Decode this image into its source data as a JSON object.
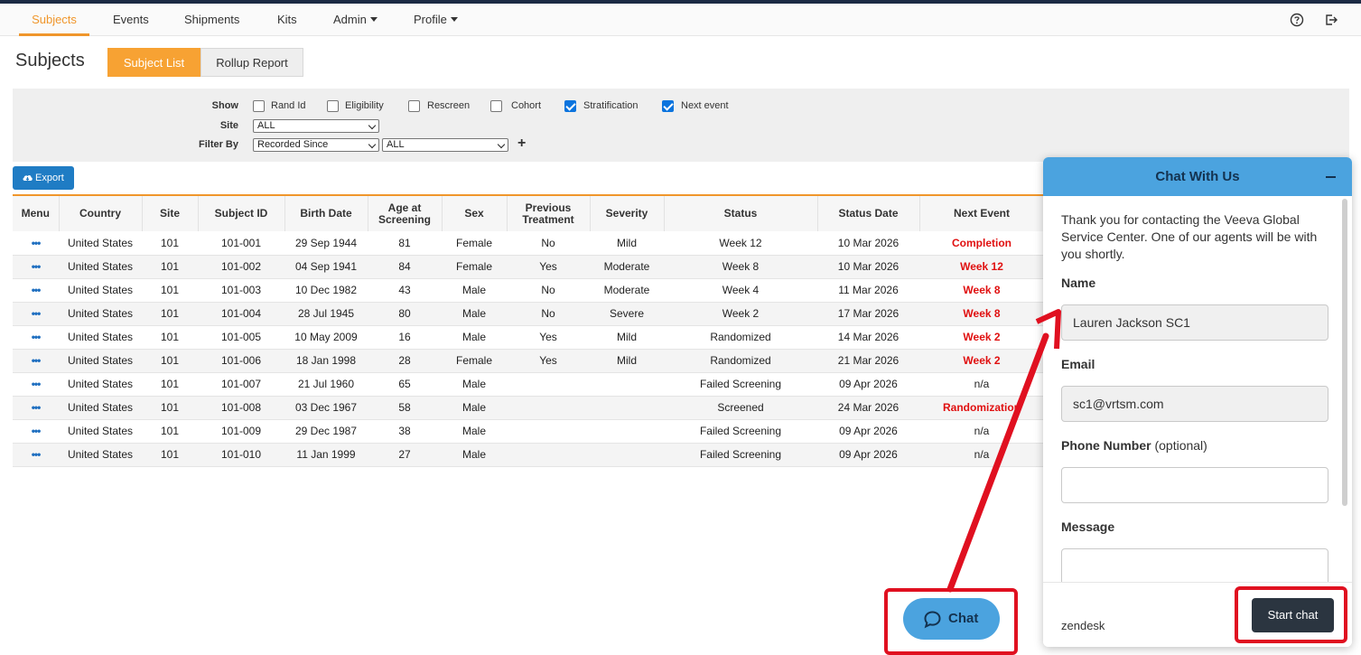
{
  "nav": {
    "items": [
      "Subjects",
      "Events",
      "Shipments",
      "Kits",
      "Admin",
      "Profile"
    ],
    "active": "Subjects",
    "help_icon": "help-circle-icon",
    "logout_icon": "logout-icon"
  },
  "page": {
    "title": "Subjects",
    "tabs": [
      "Subject List",
      "Rollup Report"
    ],
    "active_tab": "Subject List"
  },
  "filters": {
    "show_label": "Show",
    "show_options": [
      {
        "label": "Rand Id",
        "checked": false
      },
      {
        "label": "Eligibility",
        "checked": false
      },
      {
        "label": "Rescreen",
        "checked": false
      },
      {
        "label": "Cohort",
        "checked": false
      },
      {
        "label": "Stratification",
        "checked": true
      },
      {
        "label": "Next event",
        "checked": true
      }
    ],
    "site_label": "Site",
    "site_value": "ALL",
    "filter_by_label": "Filter By",
    "filter_by_value": "Recorded Since",
    "filter_value": "ALL",
    "add_symbol": "+"
  },
  "export": {
    "label": "Export",
    "icon": "cloud-download-icon"
  },
  "table": {
    "headers": [
      "Menu",
      "Country",
      "Site",
      "Subject ID",
      "Birth Date",
      "Age at Screening",
      "Sex",
      "Previous Treatment",
      "Severity",
      "Status",
      "Status Date",
      "Next Event"
    ],
    "menu_glyph": "•••",
    "rows": [
      [
        "United States",
        "101",
        "101-001",
        "29 Sep 1944",
        "81",
        "Female",
        "No",
        "Mild",
        "Week 12",
        "10 Mar 2026",
        "Completion"
      ],
      [
        "United States",
        "101",
        "101-002",
        "04 Sep 1941",
        "84",
        "Female",
        "Yes",
        "Moderate",
        "Week 8",
        "10 Mar 2026",
        "Week 12"
      ],
      [
        "United States",
        "101",
        "101-003",
        "10 Dec 1982",
        "43",
        "Male",
        "No",
        "Moderate",
        "Week 4",
        "11 Mar 2026",
        "Week 8"
      ],
      [
        "United States",
        "101",
        "101-004",
        "28 Jul 1945",
        "80",
        "Male",
        "No",
        "Severe",
        "Week 2",
        "17 Mar 2026",
        "Week 8"
      ],
      [
        "United States",
        "101",
        "101-005",
        "10 May 2009",
        "16",
        "Male",
        "Yes",
        "Mild",
        "Randomized",
        "14 Mar 2026",
        "Week 2"
      ],
      [
        "United States",
        "101",
        "101-006",
        "18 Jan 1998",
        "28",
        "Female",
        "Yes",
        "Mild",
        "Randomized",
        "21 Mar 2026",
        "Week 2"
      ],
      [
        "United States",
        "101",
        "101-007",
        "21 Jul 1960",
        "65",
        "Male",
        "",
        "",
        "Failed Screening",
        "09 Apr 2026",
        "n/a"
      ],
      [
        "United States",
        "101",
        "101-008",
        "03 Dec 1967",
        "58",
        "Male",
        "",
        "",
        "Screened",
        "24 Mar 2026",
        "Randomization"
      ],
      [
        "United States",
        "101",
        "101-009",
        "29 Dec 1987",
        "38",
        "Male",
        "",
        "",
        "Failed Screening",
        "09 Apr 2026",
        "n/a"
      ],
      [
        "United States",
        "101",
        "101-010",
        "11 Jan 1999",
        "27",
        "Male",
        "",
        "",
        "Failed Screening",
        "09 Apr 2026",
        "n/a"
      ]
    ],
    "next_event_red": [
      true,
      true,
      true,
      true,
      true,
      true,
      false,
      true,
      false,
      false
    ]
  },
  "chat": {
    "title": "Chat With Us",
    "intro": "Thank you for contacting the Veeva Global Service Center. One of our agents will be with you shortly.",
    "name_label": "Name",
    "name_value": "Lauren Jackson SC1",
    "email_label": "Email",
    "email_value": "sc1@vrtsm.com",
    "phone_label": "Phone Number",
    "phone_optional": "(optional)",
    "phone_value": "",
    "message_label": "Message",
    "message_value": "",
    "brand": "zendesk",
    "start_label": "Start chat",
    "launcher_label": "Chat",
    "launcher_icon": "chat-bubble-icon"
  },
  "annotation": {
    "color": "#e01020"
  }
}
